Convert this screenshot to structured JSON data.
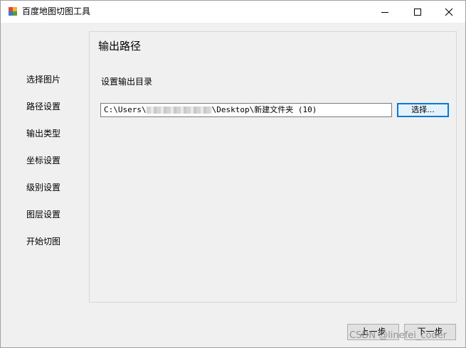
{
  "window": {
    "title": "百度地图切图工具",
    "controls": {
      "minimize": "minimize-icon",
      "maximize": "maximize-icon",
      "close": "close-icon"
    }
  },
  "sidebar": {
    "items": [
      {
        "label": "选择图片"
      },
      {
        "label": "路径设置"
      },
      {
        "label": "输出类型"
      },
      {
        "label": "坐标设置"
      },
      {
        "label": "级别设置"
      },
      {
        "label": "图层设置"
      },
      {
        "label": "开始切图"
      }
    ]
  },
  "panel": {
    "title": "输出路径",
    "field_label": "设置输出目录",
    "path_prefix": "C:\\Users\\",
    "path_suffix": "\\Desktop\\新建文件夹 (10)",
    "select_button": "选择..."
  },
  "footer": {
    "prev_button": "上一步",
    "next_button": "下一步"
  },
  "watermark": "CSDN @linefei_coder"
}
